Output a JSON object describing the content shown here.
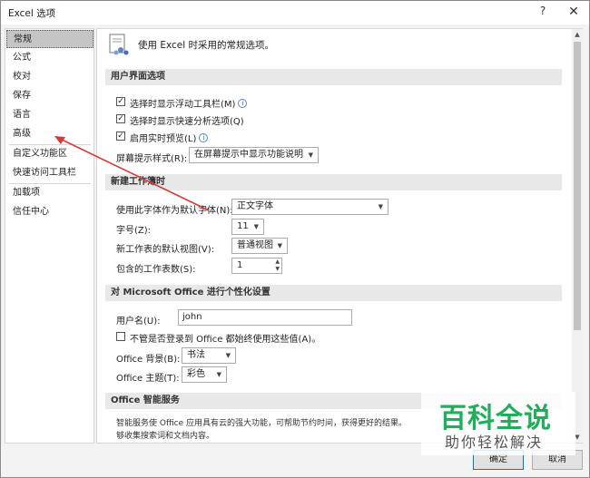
{
  "window": {
    "title": "Excel 选项",
    "help": "?",
    "close": "✕"
  },
  "sidebar": {
    "items": [
      "常规",
      "公式",
      "校对",
      "保存",
      "语言",
      "高级",
      "自定义功能区",
      "快速访问工具栏",
      "加载项",
      "信任中心"
    ],
    "selected": "常规"
  },
  "intro": "使用 Excel 时采用的常规选项。",
  "ui_section": {
    "title": "用户界面选项",
    "opt1": "选择时显示浮动工具栏(M)",
    "opt2": "选择时显示快速分析选项(Q)",
    "opt3": "启用实时预览(L)",
    "tip_label": "屏幕提示样式(R):",
    "tip_value": "在屏幕提示中显示功能说明"
  },
  "wb_section": {
    "title": "新建工作簿时",
    "font_label": "使用此字体作为默认字体(N):",
    "font_value": "正文字体",
    "size_label": "字号(Z):",
    "size_value": "11",
    "view_label": "新工作表的默认视图(V):",
    "view_value": "普通视图",
    "sheets_label": "包含的工作表数(S):",
    "sheets_value": "1"
  },
  "personal_section": {
    "title": "对 Microsoft Office 进行个性化设置",
    "user_label": "用户名(U):",
    "user_value": "john",
    "always_label": "不管是否登录到 Office 都始终使用这些值(A)。",
    "bg_label": "Office 背景(B):",
    "bg_value": "书法",
    "theme_label": "Office 主题(T):",
    "theme_value": "彩色"
  },
  "smart_section": {
    "title": "Office 智能服务",
    "desc1": "智能服务使 Office 应用具有云的强大功能，可帮助节约时间，获得更好的结果。",
    "desc2": "够收集搜索词和文档内容。"
  },
  "buttons": {
    "ok": "确定",
    "cancel": "取消"
  },
  "watermark": {
    "main": "百科全说",
    "sub": "助你轻松解决"
  },
  "colors": {
    "accent": "#0078d7",
    "arrow": "#d43a3a",
    "watermark": "#1fae5c"
  }
}
